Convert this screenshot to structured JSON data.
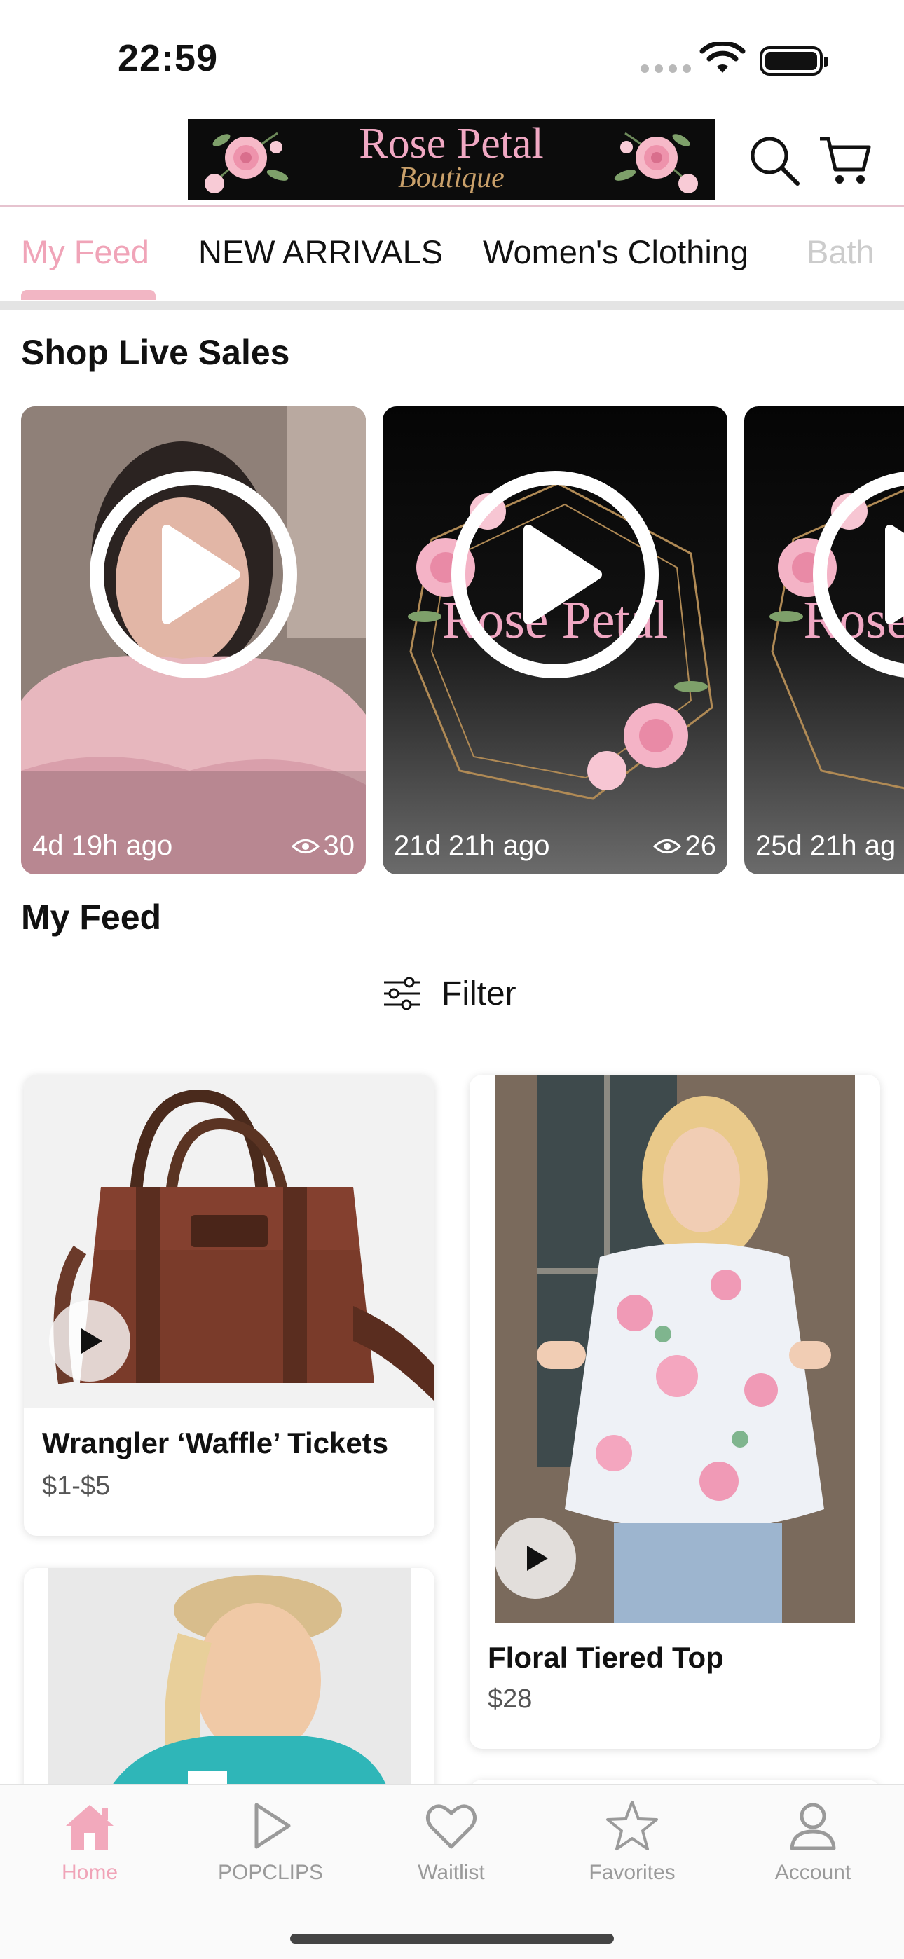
{
  "status_bar": {
    "time": "22:59"
  },
  "header": {
    "logo_line1": "Rose Petal",
    "logo_line2": "Boutique",
    "search_icon": "search-icon",
    "cart_icon": "cart-icon"
  },
  "tabs": [
    {
      "label": "My Feed",
      "active": true
    },
    {
      "label": "NEW ARRIVALS",
      "active": false
    },
    {
      "label": "Women's Clothing",
      "active": false
    },
    {
      "label": "Bath",
      "active": false
    }
  ],
  "live_section": {
    "title": "Shop Live Sales",
    "items": [
      {
        "time": "4d 19h ago",
        "views": "30"
      },
      {
        "time": "21d 21h ago",
        "views": "26"
      },
      {
        "time": "25d 21h ag",
        "views": ""
      }
    ]
  },
  "feed_section": {
    "title": "My Feed",
    "filter_label": "Filter"
  },
  "products": [
    {
      "name": "Wrangler ‘Waffle’ Tickets",
      "price": "$1-$5"
    },
    {
      "name": "Floral Tiered Top",
      "price": "$28"
    }
  ],
  "bottom_nav": [
    {
      "label": "Home",
      "icon": "home-icon",
      "active": true
    },
    {
      "label": "POPCLIPS",
      "icon": "play-icon",
      "active": false
    },
    {
      "label": "Waitlist",
      "icon": "heart-icon",
      "active": false
    },
    {
      "label": "Favorites",
      "icon": "star-icon",
      "active": false
    },
    {
      "label": "Account",
      "icon": "account-icon",
      "active": false
    }
  ],
  "colors": {
    "accent_pink": "#f0a4b8",
    "logo_background": "#0c0c0c",
    "logo_gold": "#c9a06a"
  }
}
